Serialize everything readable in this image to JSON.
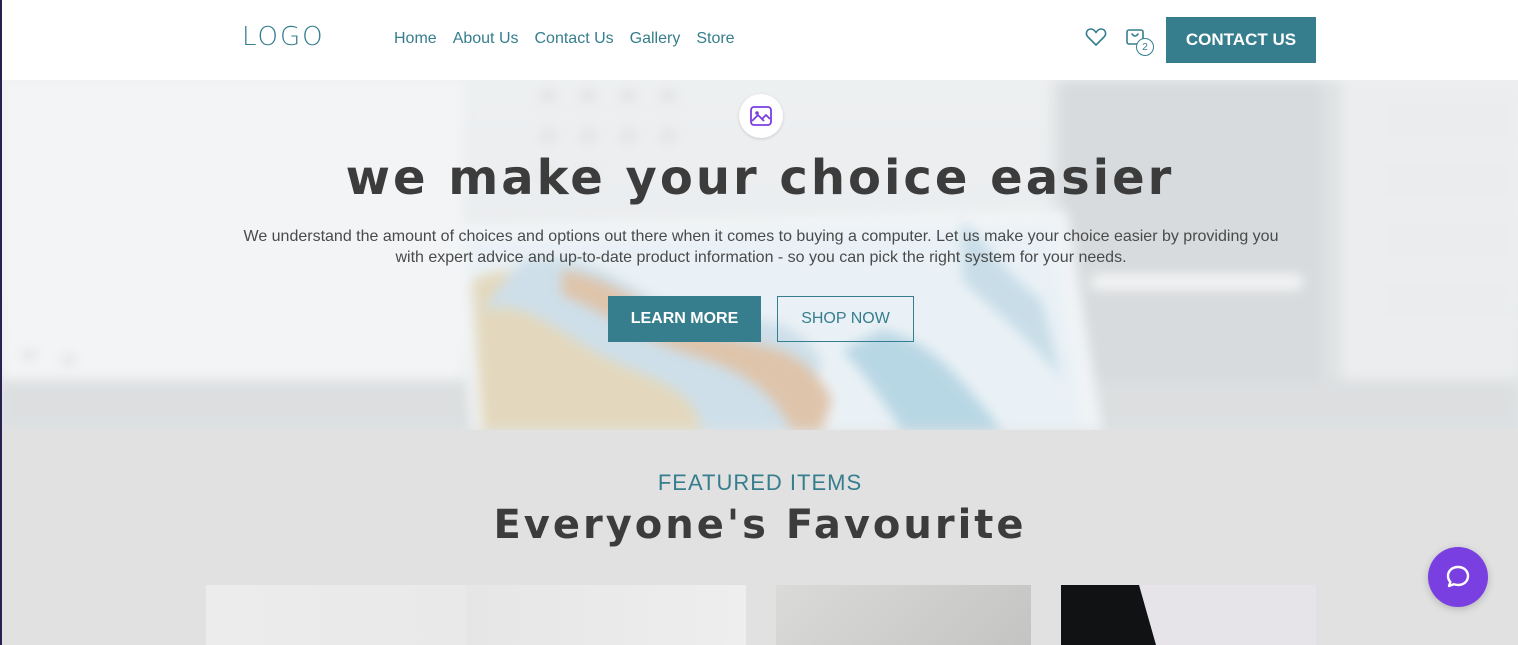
{
  "header": {
    "logo": "LOGO",
    "nav": [
      "Home",
      "About Us",
      "Contact Us",
      "Gallery",
      "Store"
    ],
    "cart_count": "2",
    "contact_button": "CONTACT US"
  },
  "hero": {
    "title": "we make your choice easier",
    "subtitle": "We understand the amount of choices and options out there when it comes to buying a computer. Let us make your choice easier by providing you with expert advice and up-to-date product information - so you can pick the right system for your needs.",
    "learn_more": "LEARN MORE",
    "shop_now": "SHOP NOW"
  },
  "featured": {
    "label": "FEATURED ITEMS",
    "title": "Everyone's Favourite"
  },
  "icons": {
    "header": [
      "heart-icon",
      "cart-icon"
    ],
    "hero_badge": "image-icon",
    "chat": "chat-bubble-icon"
  },
  "colors": {
    "accent": "#367e8d",
    "heading": "#3c3c3c",
    "chat": "#7a3fe0",
    "featured_bg": "#e1e1e1"
  }
}
